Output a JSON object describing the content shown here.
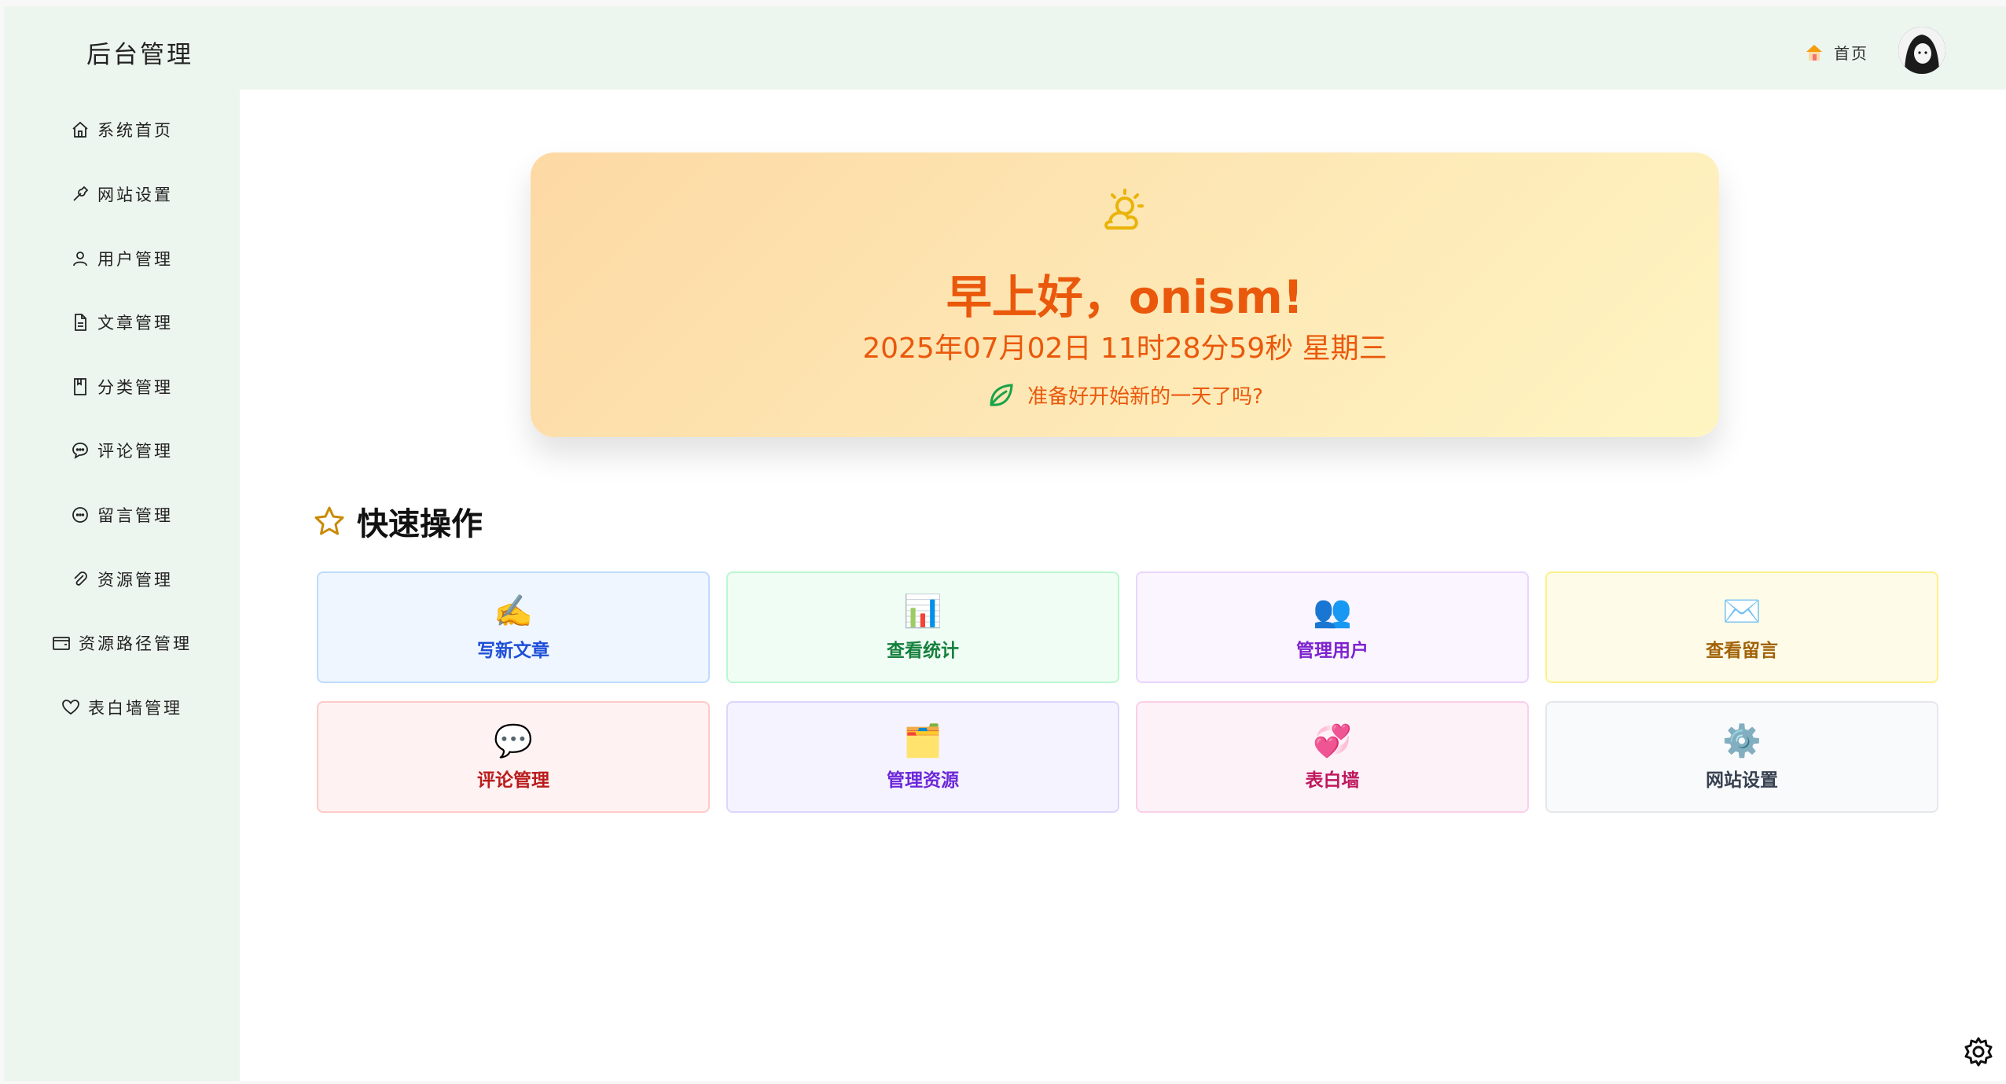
{
  "app": {
    "title": "后台管理"
  },
  "header": {
    "home_label": "首页",
    "home_icon": "house-emoji-icon",
    "avatar": "avatar"
  },
  "sidebar": {
    "items": [
      {
        "label": "系统首页",
        "icon": "home-icon"
      },
      {
        "label": "网站设置",
        "icon": "wrench-icon"
      },
      {
        "label": "用户管理",
        "icon": "user-icon"
      },
      {
        "label": "文章管理",
        "icon": "document-icon"
      },
      {
        "label": "分类管理",
        "icon": "book-icon"
      },
      {
        "label": "评论管理",
        "icon": "chat-icon"
      },
      {
        "label": "留言管理",
        "icon": "message-icon"
      },
      {
        "label": "资源管理",
        "icon": "paperclip-icon"
      },
      {
        "label": "资源路径管理",
        "icon": "wallet-icon"
      },
      {
        "label": "表白墙管理",
        "icon": "heart-icon"
      }
    ]
  },
  "hero": {
    "greeting": "早上好，onism!",
    "datetime": "2025年07月02日 11时28分59秒 星期三",
    "motto": "准备好开始新的一天了吗?",
    "colors": {
      "text": "#ea580c",
      "gradient_start": "#fdd9a4",
      "gradient_end": "#fef5c3"
    }
  },
  "quick_actions": {
    "title": "快速操作",
    "items": [
      {
        "label": "写新文章",
        "emoji": "✍️",
        "icon": "writing-hand-icon",
        "bg": "#eff6ff",
        "border": "#bfdbfe",
        "color": "#1d4ed8"
      },
      {
        "label": "查看统计",
        "emoji": "📊",
        "icon": "bar-chart-icon",
        "bg": "#f0fdf4",
        "border": "#bbf7d0",
        "color": "#15803d"
      },
      {
        "label": "管理用户",
        "emoji": "👥",
        "icon": "users-icon",
        "bg": "#faf5ff",
        "border": "#e9d5ff",
        "color": "#7e22ce"
      },
      {
        "label": "查看留言",
        "emoji": "✉️",
        "icon": "envelope-icon",
        "bg": "#fefce8",
        "border": "#fef08a",
        "color": "#a16207"
      },
      {
        "label": "评论管理",
        "emoji": "💬",
        "icon": "speech-bubble-icon",
        "bg": "#fef2f2",
        "border": "#fecaca",
        "color": "#b91c1c"
      },
      {
        "label": "管理资源",
        "emoji": "🗂️",
        "icon": "folder-icon",
        "bg": "#f5f3ff",
        "border": "#ddd6fe",
        "color": "#6d28d9"
      },
      {
        "label": "表白墙",
        "emoji": "💞",
        "icon": "hearts-icon",
        "bg": "#fdf2f8",
        "border": "#fbcfe8",
        "color": "#be185d"
      },
      {
        "label": "网站设置",
        "emoji": "⚙️",
        "icon": "gear-icon",
        "bg": "#f9fafb",
        "border": "#e5e7eb",
        "color": "#374151"
      }
    ]
  },
  "floating": {
    "settings_icon": "gear-icon"
  }
}
